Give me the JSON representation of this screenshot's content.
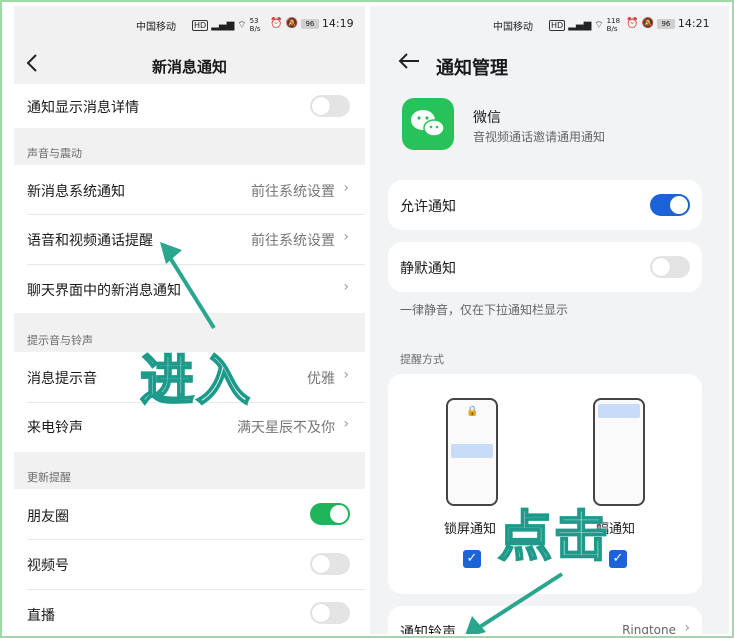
{
  "left": {
    "status": {
      "carrier": "中国移动",
      "speed": "53 B/s",
      "battery": "96",
      "time": "14:19"
    },
    "header": {
      "title": "新消息通知"
    },
    "rows": [
      {
        "label": "通知显示消息详情"
      },
      {
        "section": "声音与震动"
      },
      {
        "label": "新消息系统通知",
        "value": "前往系统设置"
      },
      {
        "label": "语音和视频通话提醒",
        "value": "前往系统设置"
      },
      {
        "label": "聊天界面中的新消息通知"
      },
      {
        "section": "提示音与铃声"
      },
      {
        "label": "消息提示音",
        "value": "优雅"
      },
      {
        "label": "来电铃声",
        "value": "满天星辰不及你"
      },
      {
        "section": "更新提醒"
      },
      {
        "label": "朋友圈"
      },
      {
        "label": "视频号"
      },
      {
        "label": "直播"
      }
    ],
    "toggles": {
      "detail": false,
      "moments": true,
      "channels": false,
      "live": false
    }
  },
  "right": {
    "status": {
      "carrier": "中国移动",
      "speed": "118 B/s",
      "battery": "96",
      "time": "14:21"
    },
    "header": {
      "title": "通知管理"
    },
    "app": {
      "name": "微信",
      "desc": "音视频通话邀请通用通知"
    },
    "allow": {
      "label": "允许通知",
      "on": true
    },
    "silent": {
      "label": "静默通知",
      "on": false,
      "note": "一律静音，仅在下拉通知栏显示"
    },
    "remind": {
      "section": "提醒方式",
      "lock_label": "锁屏通知",
      "banner_label": "横幅通知",
      "banner_visible": "幅通知"
    },
    "ringtone": {
      "label": "通知铃声",
      "value": "Ringtone"
    }
  },
  "overlays": {
    "enter": "进入",
    "click": "点击"
  },
  "colors": {
    "wechat_green": "#27c25a",
    "toggle_green": "#20b55a",
    "toggle_blue": "#1b63d6",
    "arrow": "#2aa68f"
  }
}
